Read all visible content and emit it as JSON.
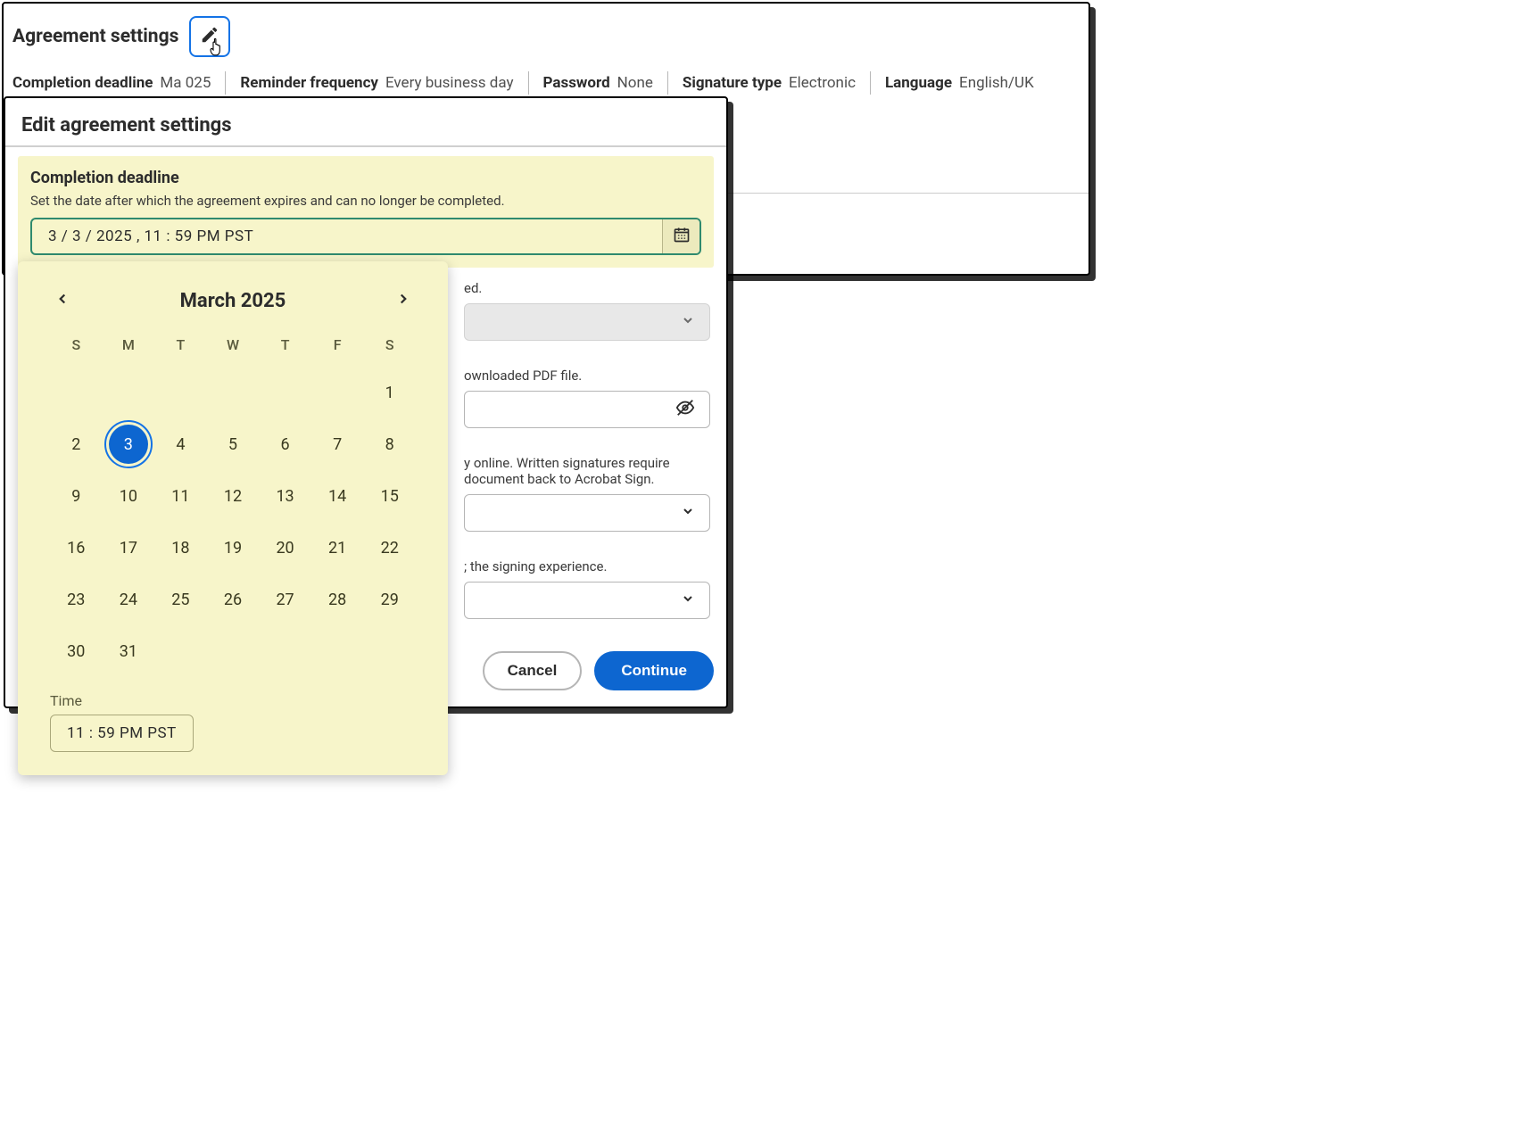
{
  "header": {
    "title": "Agreement settings"
  },
  "summary": {
    "completion_deadline_label": "Completion deadline",
    "completion_deadline_value": "Ma          025",
    "reminder_label": "Reminder frequency",
    "reminder_value": "Every business day",
    "password_label": "Password",
    "password_value": "None",
    "sigtype_label": "Signature type",
    "sigtype_value": "Electronic",
    "language_label": "Language",
    "language_value": "English/UK"
  },
  "modal": {
    "title": "Edit agreement settings",
    "deadline_section_title": "Completion deadline",
    "deadline_section_desc": "Set the date after which the agreement expires and can no longer be completed.",
    "deadline_value": "3 /   3 / 2025 ,   11 : 59  PM  PST",
    "bg": {
      "reminder_desc_tail": "ed.",
      "password_desc_tail": "ownloaded PDF file.",
      "sig_desc_tail_1": "y online. Written signatures require",
      "sig_desc_tail_2": "document back to Acrobat Sign.",
      "lang_desc_tail": "; the signing experience."
    },
    "cancel": "Cancel",
    "continue": "Continue"
  },
  "calendar": {
    "month": "March 2025",
    "dow": [
      "S",
      "M",
      "T",
      "W",
      "T",
      "F",
      "S"
    ],
    "days_row1": [
      "",
      "",
      "",
      "",
      "",
      "",
      "1"
    ],
    "days_row2": [
      "2",
      "3",
      "4",
      "5",
      "6",
      "7",
      "8"
    ],
    "days_row3": [
      "9",
      "10",
      "11",
      "12",
      "13",
      "14",
      "15"
    ],
    "days_row4": [
      "16",
      "17",
      "18",
      "19",
      "20",
      "21",
      "22"
    ],
    "days_row5": [
      "23",
      "24",
      "25",
      "26",
      "27",
      "28",
      "29"
    ],
    "days_row6": [
      "30",
      "31",
      "",
      "",
      "",
      "",
      ""
    ],
    "selected_day": "3",
    "time_label": "Time",
    "time_value": "11 : 59  PM  PST"
  }
}
